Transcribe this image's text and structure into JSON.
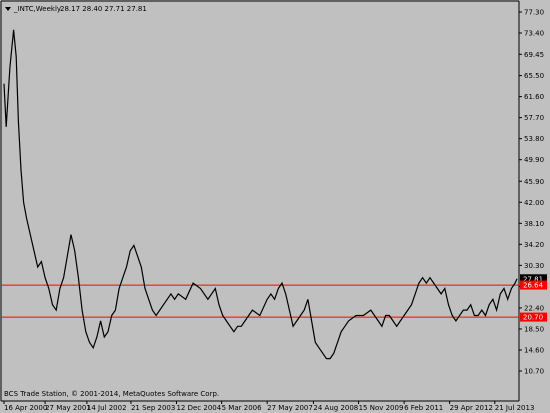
{
  "header": {
    "symbol": "_INTC,Weekly",
    "ohlc": "28.17 28.40 27.71 27.81"
  },
  "footer": {
    "copyright": "BCS Trade Station, © 2001-2014, MetaQuotes Software Corp."
  },
  "colors": {
    "background": "#c0c0c0",
    "price_line": "#000000",
    "level_line": "#ff0000",
    "level_badge": "#ff0000",
    "current_badge": "#000000"
  },
  "chart_data": {
    "type": "line",
    "title": "_INTC,Weekly",
    "ylim": [
      10.7,
      78.7
    ],
    "y_ticks": [
      "77.30",
      "73.40",
      "69.45",
      "65.50",
      "61.60",
      "57.70",
      "53.80",
      "49.90",
      "45.90",
      "42.00",
      "38.10",
      "34.20",
      "30.30",
      "26.40",
      "22.40",
      "18.50",
      "14.60",
      "10.70"
    ],
    "x_ticks": [
      "16 Apr 2000",
      "27 May 2001",
      "14 Jul 2002",
      "21 Sep 2003",
      "12 Dec 2004",
      "5 Mar 2006",
      "27 May 2007",
      "24 Aug 2008",
      "15 Nov 2009",
      "6 Feb 2011",
      "29 Apr 2012",
      "21 Jul 2013"
    ],
    "levels": [
      {
        "label": "26.64",
        "value": 26.64
      },
      {
        "label": "20.70",
        "value": 20.7
      }
    ],
    "current": {
      "label": "27.81",
      "value": 27.81
    },
    "series": [
      {
        "x": [
          2000.29,
          2000.35,
          2000.45,
          2000.55,
          2000.62,
          2000.68,
          2000.75,
          2000.82,
          2000.9,
          2001.0,
          2001.1,
          2001.2,
          2001.3,
          2001.4,
          2001.5,
          2001.6,
          2001.7,
          2001.8,
          2001.9,
          2002.0,
          2002.1,
          2002.2,
          2002.3,
          2002.4,
          2002.5,
          2002.6,
          2002.7,
          2002.8,
          2002.9,
          2003.0,
          2003.1,
          2003.2,
          2003.3,
          2003.4,
          2003.5,
          2003.6,
          2003.7,
          2003.8,
          2003.9,
          2004.0,
          2004.1,
          2004.2,
          2004.3,
          2004.4,
          2004.5,
          2004.6,
          2004.7,
          2004.8,
          2004.9,
          2005.0,
          2005.2,
          2005.4,
          2005.6,
          2005.8,
          2006.0,
          2006.1,
          2006.2,
          2006.3,
          2006.4,
          2006.5,
          2006.6,
          2006.7,
          2006.8,
          2006.9,
          2007.0,
          2007.2,
          2007.4,
          2007.5,
          2007.6,
          2007.7,
          2007.8,
          2007.9,
          2008.0,
          2008.1,
          2008.2,
          2008.3,
          2008.4,
          2008.5,
          2008.6,
          2008.7,
          2008.8,
          2008.9,
          2009.0,
          2009.1,
          2009.2,
          2009.3,
          2009.4,
          2009.5,
          2009.6,
          2009.8,
          2010.0,
          2010.2,
          2010.4,
          2010.5,
          2010.6,
          2010.7,
          2010.8,
          2010.9,
          2011.0,
          2011.1,
          2011.2,
          2011.3,
          2011.4,
          2011.5,
          2011.6,
          2011.7,
          2011.8,
          2011.9,
          2012.0,
          2012.1,
          2012.2,
          2012.3,
          2012.4,
          2012.5,
          2012.6,
          2012.7,
          2012.8,
          2012.9,
          2013.0,
          2013.1,
          2013.2,
          2013.3,
          2013.4,
          2013.5,
          2013.6,
          2013.7,
          2013.8,
          2013.9,
          2014.0,
          2014.1,
          2014.15
        ],
        "values": [
          64,
          56,
          67,
          74,
          69,
          57,
          48,
          42,
          39,
          36,
          33,
          30,
          31,
          28,
          26,
          23,
          22,
          26,
          28,
          32,
          36,
          33,
          28,
          22,
          18,
          16,
          15,
          17,
          20,
          17,
          18,
          21,
          22,
          26,
          28,
          30,
          33,
          34,
          32,
          30,
          26,
          24,
          22,
          21,
          22,
          23,
          24,
          25,
          24,
          25,
          24,
          27,
          26,
          24,
          26,
          23,
          21,
          20,
          19,
          18,
          19,
          19,
          20,
          21,
          22,
          21,
          24,
          25,
          24,
          26,
          27,
          25,
          22,
          19,
          20,
          21,
          22,
          24,
          20,
          16,
          15,
          14,
          13,
          13,
          14,
          16,
          18,
          19,
          20,
          21,
          21,
          22,
          20,
          19,
          21,
          21,
          20,
          19,
          20,
          21,
          22,
          23,
          25,
          27,
          28,
          27,
          28,
          27,
          26,
          25,
          26,
          23,
          21,
          20,
          21,
          22,
          22,
          23,
          21,
          21,
          22,
          21,
          23,
          24,
          22,
          25,
          26,
          24,
          26,
          27,
          27.81
        ]
      }
    ]
  }
}
